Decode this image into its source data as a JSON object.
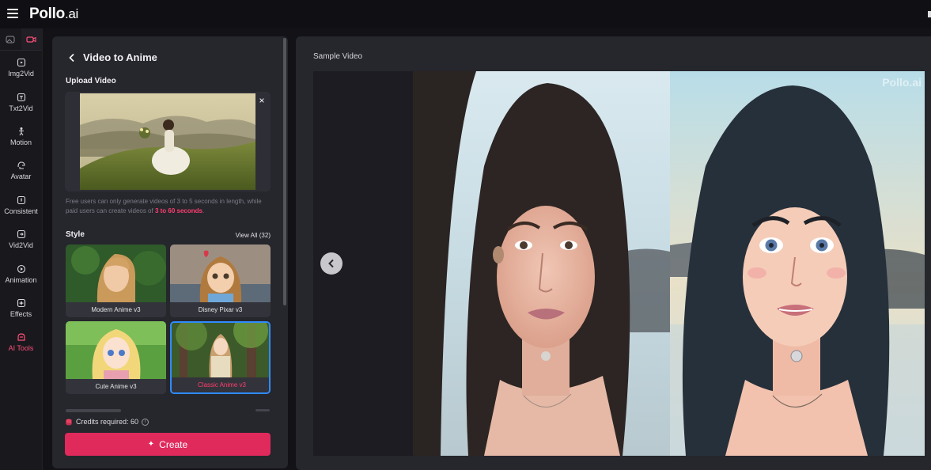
{
  "app": {
    "logo_main": "Pollo",
    "logo_suffix": ".ai"
  },
  "nav": {
    "items": [
      {
        "label": "Img2Vid",
        "icon": "image-to-video-icon"
      },
      {
        "label": "Txt2Vid",
        "icon": "text-to-video-icon"
      },
      {
        "label": "Motion",
        "icon": "motion-icon"
      },
      {
        "label": "Avatar",
        "icon": "avatar-icon"
      },
      {
        "label": "Consistent",
        "icon": "consistent-icon"
      },
      {
        "label": "Vid2Vid",
        "icon": "video-to-video-icon"
      },
      {
        "label": "Animation",
        "icon": "animation-icon"
      },
      {
        "label": "Effects",
        "icon": "effects-icon"
      },
      {
        "label": "AI Tools",
        "icon": "ai-tools-icon",
        "active": true
      }
    ]
  },
  "panel": {
    "title": "Video to Anime",
    "upload_label": "Upload Video",
    "notice_prefix": "Free users can only generate videos of 3 to 5 seconds in length, while paid users can create videos of ",
    "notice_highlight": "3 to 60 seconds",
    "notice_suffix": ".",
    "style_label": "Style",
    "view_all": "View All (32)",
    "styles": [
      {
        "name": "Modern Anime v3",
        "selected": false
      },
      {
        "name": "Disney Pixar v3",
        "selected": false
      },
      {
        "name": "Cute Anime v3",
        "selected": false
      },
      {
        "name": "Classic Anime v3",
        "selected": true
      }
    ],
    "credits": "Credits required: 60",
    "create_label": "Create"
  },
  "main": {
    "sample_label": "Sample Video",
    "watermark": "Pollo.ai"
  },
  "colors": {
    "accent": "#e02a5c",
    "highlight": "#ff3f6e",
    "selected_border": "#2f8cff"
  }
}
